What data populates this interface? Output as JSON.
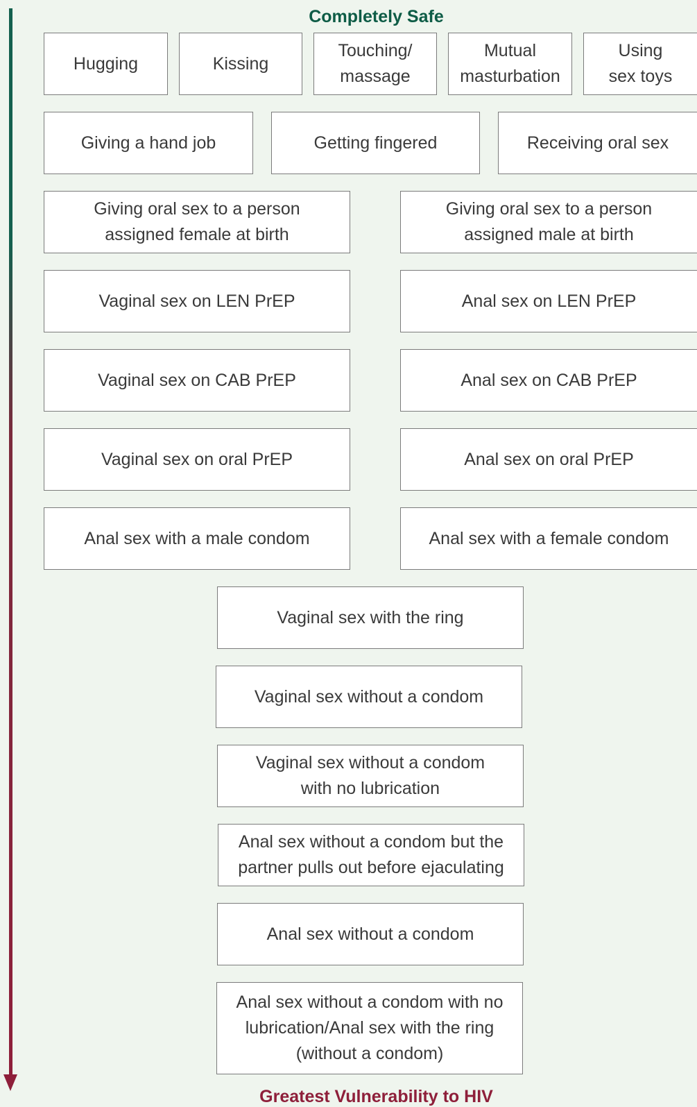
{
  "titles": {
    "top": "Completely Safe",
    "bottom": "Greatest Vulnerability to HIV"
  },
  "colors": {
    "safe": "#0e5c46",
    "risk": "#8e1f3a",
    "background": "#eff5ee"
  },
  "rows": [
    [
      "Hugging",
      "Kissing",
      "Touching/\nmassage",
      "Mutual\nmasturbation",
      "Using\nsex toys"
    ],
    [
      "Giving a hand job",
      "Getting fingered",
      "Receiving oral sex"
    ],
    [
      "Giving oral sex to a person\nassigned female at birth",
      "Giving oral sex to a person\nassigned male at birth"
    ],
    [
      "Vaginal sex on LEN PrEP",
      "Anal sex on LEN PrEP"
    ],
    [
      "Vaginal sex on CAB PrEP",
      "Anal sex on CAB PrEP"
    ],
    [
      "Vaginal sex on oral PrEP",
      "Anal sex on oral PrEP"
    ],
    [
      "Anal sex with a male condom",
      "Anal sex with a female condom"
    ],
    [
      "Vaginal sex with the ring"
    ],
    [
      "Vaginal sex without a condom"
    ],
    [
      "Vaginal sex without a condom\nwith no lubrication"
    ],
    [
      "Anal sex without a condom but the\npartner pulls out before ejaculating"
    ],
    [
      "Anal sex without a condom"
    ],
    [
      "Anal sex without a condom with no\nlubrication/Anal sex with the ring\n(without a condom)"
    ]
  ]
}
